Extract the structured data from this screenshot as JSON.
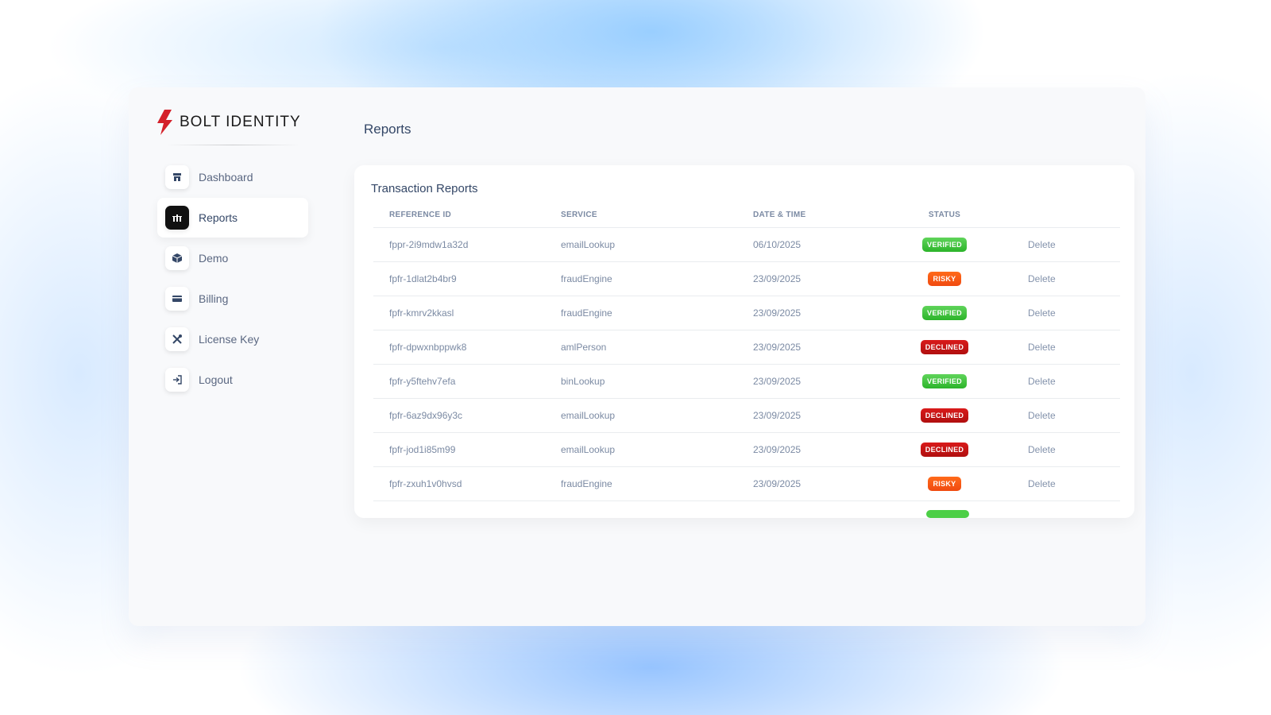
{
  "brand": {
    "name": "BOLT IDENTITY",
    "accent": "#d4202a"
  },
  "sidebar": {
    "items": [
      {
        "label": "Dashboard",
        "icon": "store-icon",
        "active": false
      },
      {
        "label": "Reports",
        "icon": "chart-bars-icon",
        "active": true
      },
      {
        "label": "Demo",
        "icon": "box-icon",
        "active": false
      },
      {
        "label": "Billing",
        "icon": "credit-card-icon",
        "active": false
      },
      {
        "label": "License Key",
        "icon": "tools-icon",
        "active": false
      },
      {
        "label": "Logout",
        "icon": "logout-icon",
        "active": false
      }
    ]
  },
  "page": {
    "title": "Reports"
  },
  "reports": {
    "title": "Transaction Reports",
    "columns": [
      "REFERENCE ID",
      "SERVICE",
      "DATE & TIME",
      "STATUS",
      ""
    ],
    "rows": [
      {
        "ref": "fppr-2i9mdw1a32d",
        "service": "emailLookup",
        "date": "06/10/2025",
        "status": "VERIFIED",
        "action": "Delete"
      },
      {
        "ref": "fpfr-1dlat2b4br9",
        "service": "fraudEngine",
        "date": "23/09/2025",
        "status": "RISKY",
        "action": "Delete"
      },
      {
        "ref": "fpfr-kmrv2kkasl",
        "service": "fraudEngine",
        "date": "23/09/2025",
        "status": "VERIFIED",
        "action": "Delete"
      },
      {
        "ref": "fpfr-dpwxnbppwk8",
        "service": "amlPerson",
        "date": "23/09/2025",
        "status": "DECLINED",
        "action": "Delete"
      },
      {
        "ref": "fpfr-y5ftehv7efa",
        "service": "binLookup",
        "date": "23/09/2025",
        "status": "VERIFIED",
        "action": "Delete"
      },
      {
        "ref": "fpfr-6az9dx96y3c",
        "service": "emailLookup",
        "date": "23/09/2025",
        "status": "DECLINED",
        "action": "Delete"
      },
      {
        "ref": "fpfr-jod1i85m99",
        "service": "emailLookup",
        "date": "23/09/2025",
        "status": "DECLINED",
        "action": "Delete"
      },
      {
        "ref": "fpfr-zxuh1v0hvsd",
        "service": "fraudEngine",
        "date": "23/09/2025",
        "status": "RISKY",
        "action": "Delete"
      }
    ]
  },
  "status_colors": {
    "VERIFIED": "#2cb42a",
    "RISKY": "#f04a10",
    "DECLINED": "#b00f0f"
  }
}
